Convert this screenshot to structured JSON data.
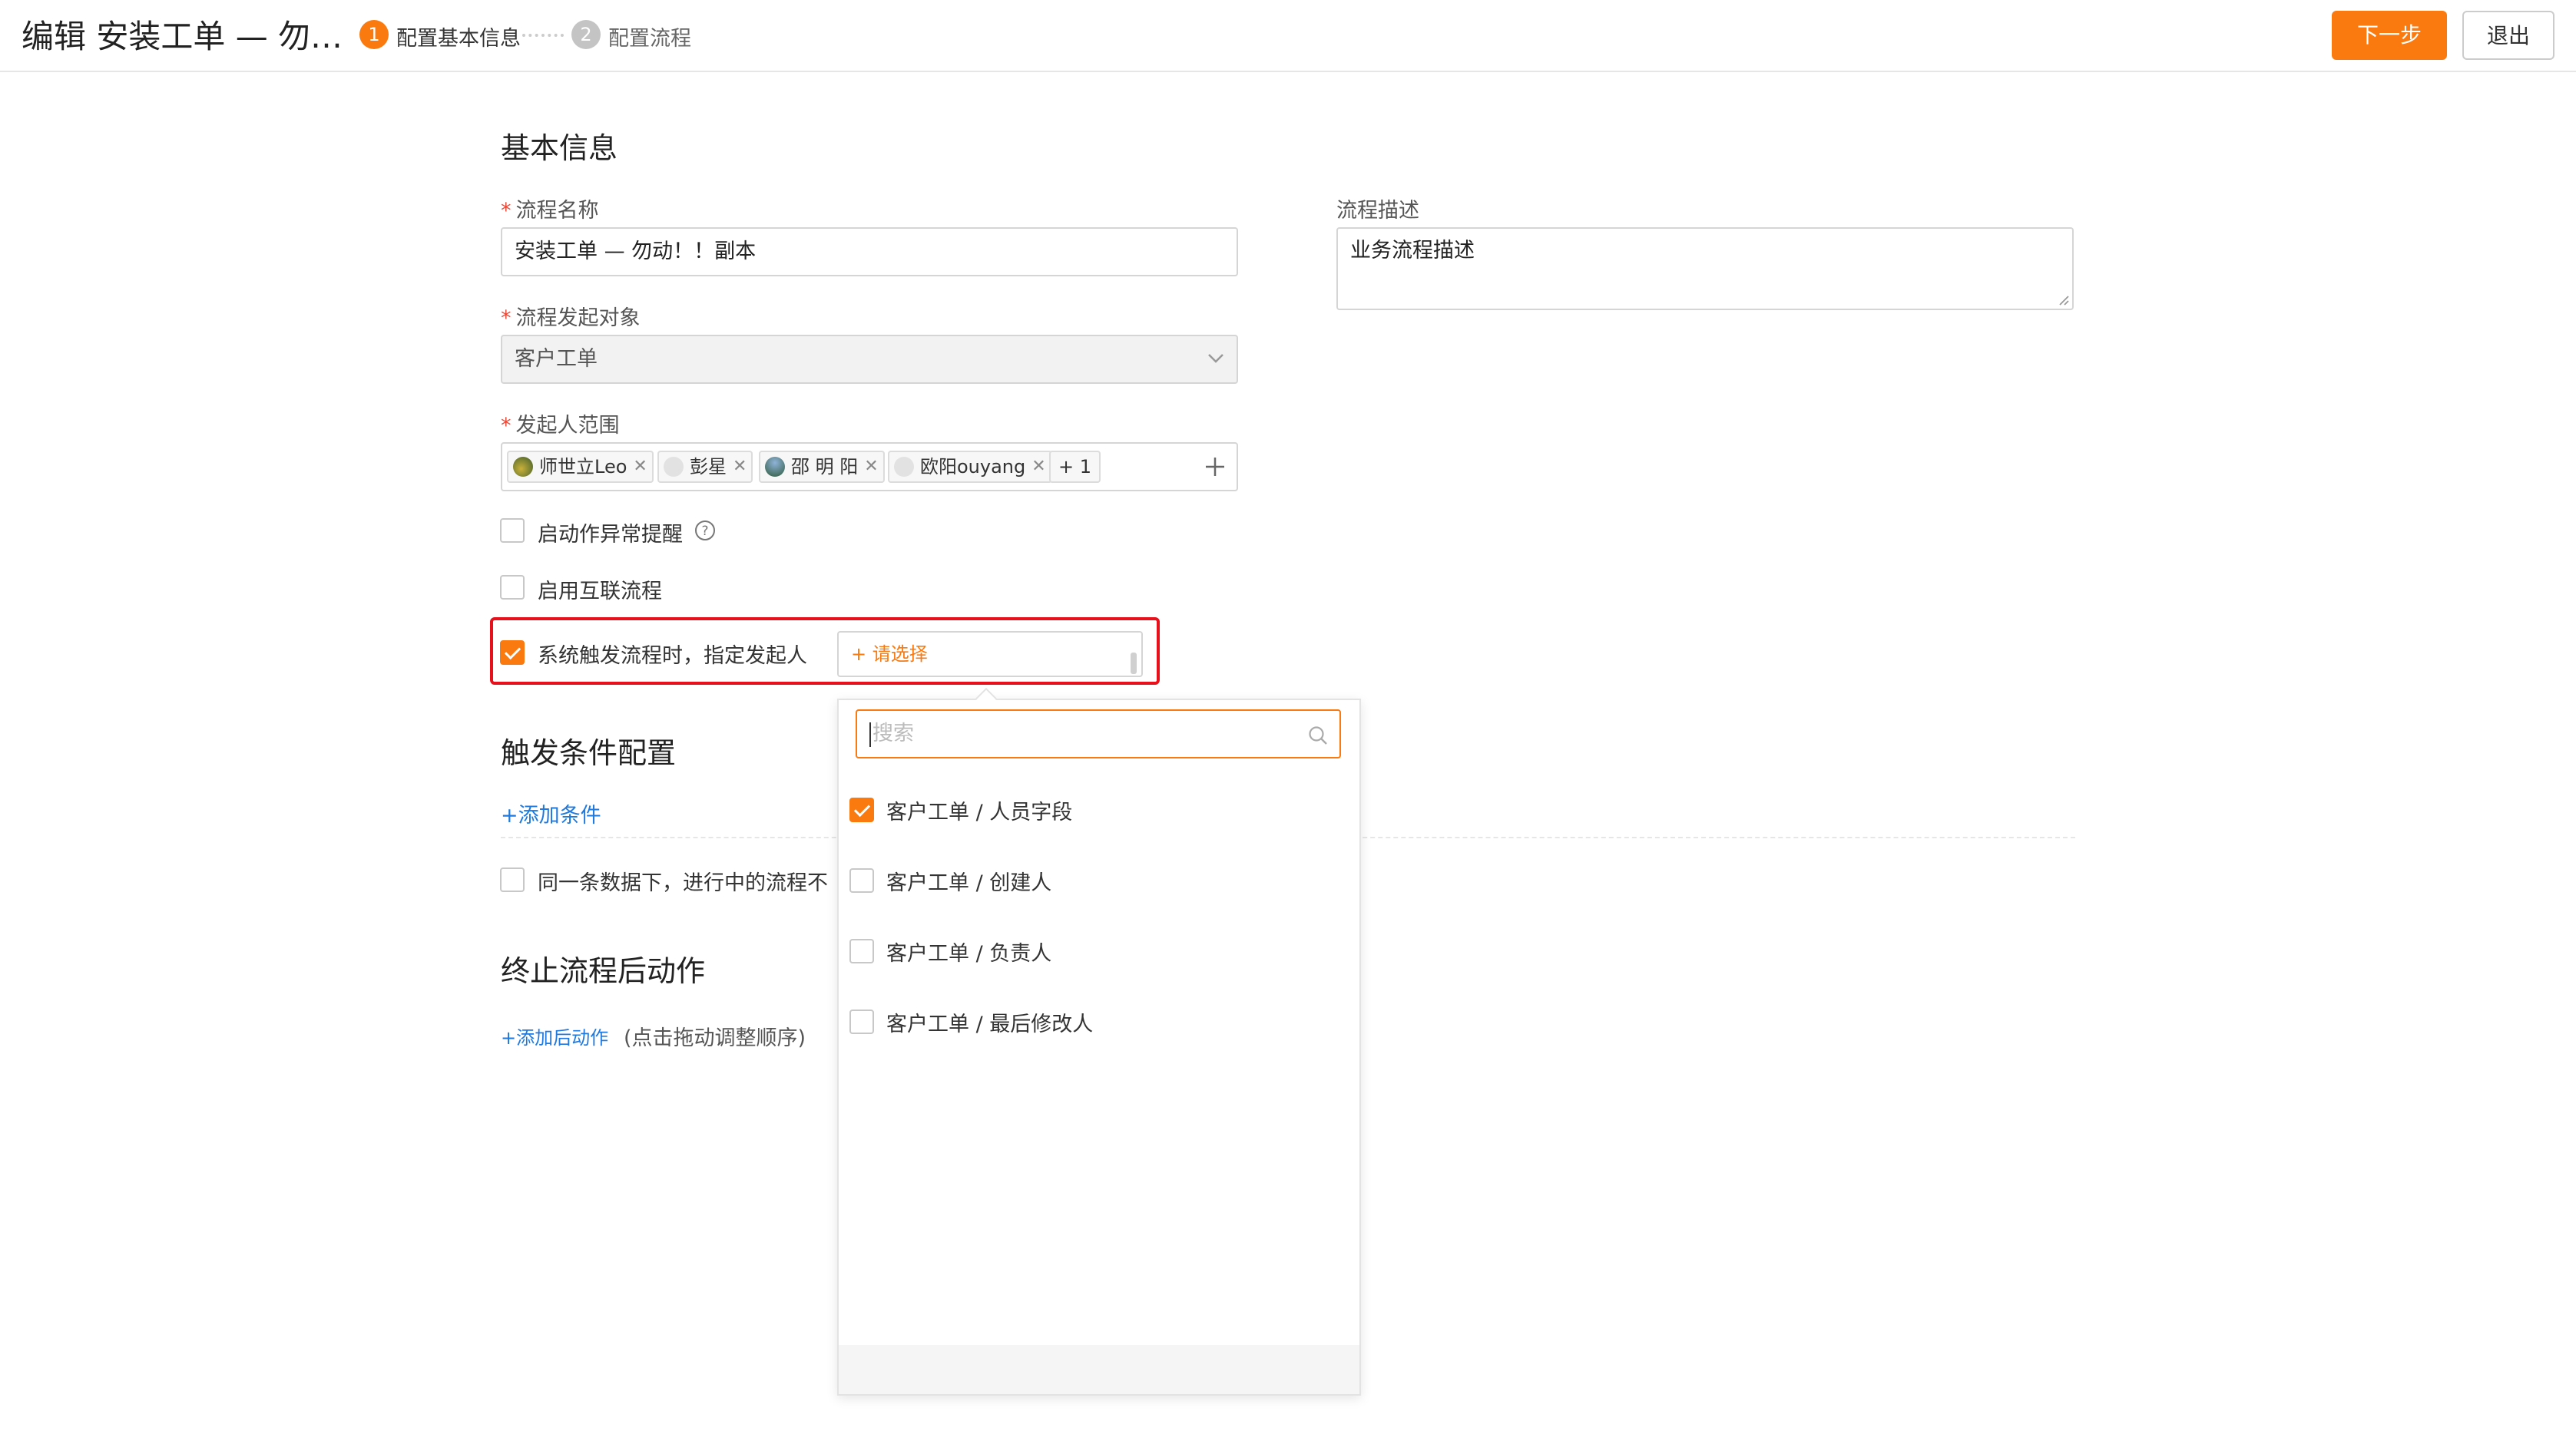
{
  "header": {
    "title": "编辑 安装工单 — 勿…",
    "steps": [
      {
        "num": "1",
        "label": "配置基本信息",
        "active": true
      },
      {
        "num": "2",
        "label": "配置流程",
        "active": false
      }
    ],
    "next_label": "下一步",
    "exit_label": "退出"
  },
  "basic": {
    "section_title": "基本信息",
    "name_label": "流程名称",
    "name_value": "安装工单 — 勿动！！副本",
    "object_label": "流程发起对象",
    "object_value": "客户工单",
    "scope_label": "发起人范围",
    "scope_tags": [
      {
        "name": "师世立Leo"
      },
      {
        "name": "彭星"
      },
      {
        "name": "邵 明 阳"
      },
      {
        "name": "欧阳ouyang"
      }
    ],
    "scope_more": "+ 1",
    "desc_label": "流程描述",
    "desc_value": "业务流程描述",
    "opt_alert_label": "启动作异常提醒",
    "opt_interconnect_label": "启用互联流程",
    "opt_system_label": "系统触发流程时，指定发起人",
    "select_placeholder": "+ 请选择"
  },
  "trigger": {
    "section_title": "触发条件配置",
    "add_condition": "+添加条件",
    "same_data_label": "同一条数据下，进行中的流程不"
  },
  "end": {
    "section_title": "终止流程后动作",
    "add_action": "+添加后动作",
    "hint": "(点击拖动调整顺序)"
  },
  "dropdown": {
    "search_placeholder": "搜索",
    "options": [
      {
        "label": "客户工单 / 人员字段",
        "checked": true
      },
      {
        "label": "客户工单 / 创建人",
        "checked": false
      },
      {
        "label": "客户工单 / 负责人",
        "checked": false
      },
      {
        "label": "客户工单 / 最后修改人",
        "checked": false
      }
    ]
  },
  "colors": {
    "accent": "#fa7a0f",
    "link": "#1f7ae0",
    "highlight": "#e8101a",
    "required": "#e84a3a"
  }
}
